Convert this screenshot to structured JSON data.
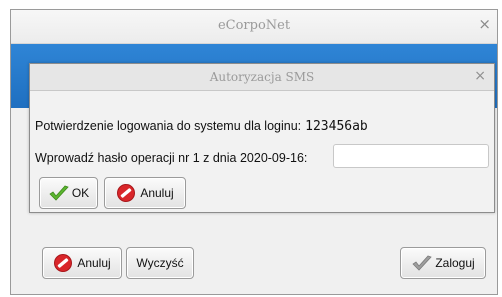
{
  "window": {
    "title": "eCorpoNet",
    "close_glyph": "×"
  },
  "sms_dialog": {
    "title": "Autoryzacja SMS",
    "close_glyph": "×",
    "confirm_text": "Potwierdzenie logowania do systemu dla loginu:",
    "login_value": "123456ab",
    "prompt_text": "Wprowadź hasło operacji nr 1 z dnia 2020-09-16:",
    "code_value": "",
    "ok_label": "OK",
    "cancel_label": "Anuluj"
  },
  "login_form": {
    "cancel_label": "Anuluj",
    "clear_label": "Wyczyść",
    "login_label": "Zaloguj"
  },
  "icons": {
    "ok": "check-icon",
    "cancel": "cancel-icon",
    "login": "check-icon"
  },
  "colors": {
    "accent_blue": "#2a7fd0",
    "check_green": "#5bb52f",
    "cancel_red": "#d9262a"
  }
}
